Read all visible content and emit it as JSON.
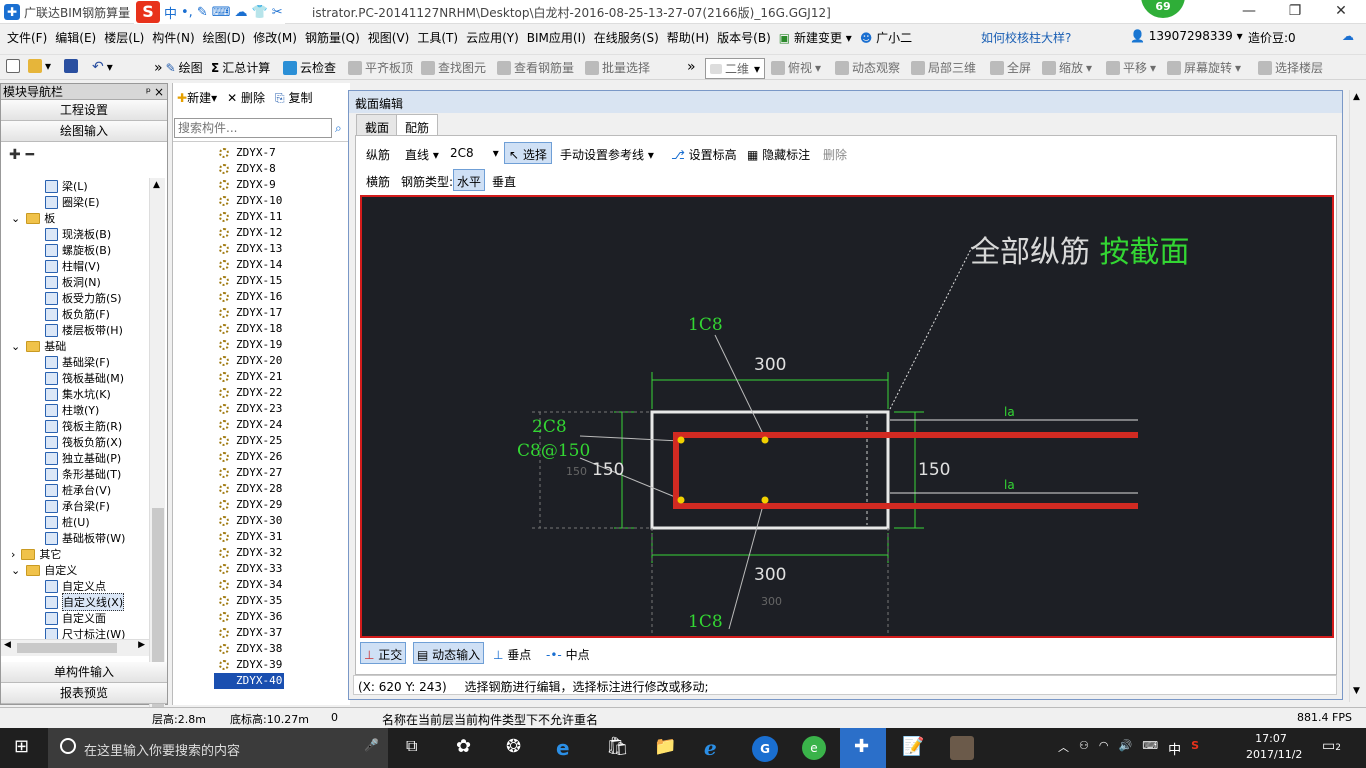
{
  "window": {
    "title_left": "广联达BIM钢筋算量",
    "title_right": "istrator.PC-20141127NRHM\\Desktop\\白龙村-2016-08-25-13-27-07(2166版)_16G.GGJ12]",
    "badge_count": "69",
    "ime_items": [
      "中",
      "•,",
      "✎",
      "⌨",
      "☁",
      "👕",
      "✂"
    ]
  },
  "menu": {
    "items": [
      "文件(F)",
      "编辑(E)",
      "楼层(L)",
      "构件(N)",
      "绘图(D)",
      "修改(M)",
      "钢筋量(Q)",
      "视图(V)",
      "工具(T)",
      "云应用(Y)",
      "BIM应用(I)",
      "在线服务(S)",
      "帮助(H)",
      "版本号(B)",
      "新建变更",
      "广小二"
    ],
    "help_link": "如何校核柱大样?",
    "phone": "13907298339",
    "price_label": "造价豆:0"
  },
  "toolbar": {
    "draw": "绘图",
    "calc": "汇总计算",
    "cloud_check": "云检查",
    "flat_top": "平齐板顶",
    "find_elem": "查找图元",
    "view_rebar": "查看钢筋量",
    "batch_select": "批量选择",
    "view_mode": "二维",
    "top_view": "俯视",
    "dynamic": "动态观察",
    "local3d": "局部三维",
    "fullscreen": "全屏",
    "zoom": "缩放",
    "pan": "平移",
    "rotate": "屏幕旋转",
    "select_floor": "选择楼层"
  },
  "nav": {
    "header": "模块导航栏",
    "pin": "ᵖ",
    "close": "×",
    "btn_project": "工程设置",
    "btn_drawing": "绘图输入",
    "btn_single": "单构件输入",
    "btn_report": "报表预览",
    "tree": [
      {
        "label": "梁(L)",
        "indent": 2,
        "kind": "item"
      },
      {
        "label": "圈梁(E)",
        "indent": 2,
        "kind": "item"
      },
      {
        "label": "板",
        "indent": 1,
        "kind": "folder"
      },
      {
        "label": "现浇板(B)",
        "indent": 2,
        "kind": "item"
      },
      {
        "label": "螺旋板(B)",
        "indent": 2,
        "kind": "item"
      },
      {
        "label": "柱帽(V)",
        "indent": 2,
        "kind": "item"
      },
      {
        "label": "板洞(N)",
        "indent": 2,
        "kind": "item"
      },
      {
        "label": "板受力筋(S)",
        "indent": 2,
        "kind": "item"
      },
      {
        "label": "板负筋(F)",
        "indent": 2,
        "kind": "item"
      },
      {
        "label": "楼层板带(H)",
        "indent": 2,
        "kind": "item"
      },
      {
        "label": "基础",
        "indent": 1,
        "kind": "folder"
      },
      {
        "label": "基础梁(F)",
        "indent": 2,
        "kind": "item"
      },
      {
        "label": "筏板基础(M)",
        "indent": 2,
        "kind": "item"
      },
      {
        "label": "集水坑(K)",
        "indent": 2,
        "kind": "item"
      },
      {
        "label": "柱墩(Y)",
        "indent": 2,
        "kind": "item"
      },
      {
        "label": "筏板主筋(R)",
        "indent": 2,
        "kind": "item"
      },
      {
        "label": "筏板负筋(X)",
        "indent": 2,
        "kind": "item"
      },
      {
        "label": "独立基础(P)",
        "indent": 2,
        "kind": "item"
      },
      {
        "label": "条形基础(T)",
        "indent": 2,
        "kind": "item"
      },
      {
        "label": "桩承台(V)",
        "indent": 2,
        "kind": "item"
      },
      {
        "label": "承台梁(F)",
        "indent": 2,
        "kind": "item"
      },
      {
        "label": "桩(U)",
        "indent": 2,
        "kind": "item"
      },
      {
        "label": "基础板带(W)",
        "indent": 2,
        "kind": "item"
      },
      {
        "label": "其它",
        "indent": 1,
        "kind": "folder-collapsed"
      },
      {
        "label": "自定义",
        "indent": 1,
        "kind": "folder"
      },
      {
        "label": "自定义点",
        "indent": 2,
        "kind": "item"
      },
      {
        "label": "自定义线(X)",
        "indent": 2,
        "kind": "item-selected"
      },
      {
        "label": "自定义面",
        "indent": 2,
        "kind": "item"
      },
      {
        "label": "尺寸标注(W)",
        "indent": 2,
        "kind": "item"
      }
    ]
  },
  "complist": {
    "new": "新建",
    "delete": "删除",
    "copy": "复制",
    "search_placeholder": "搜索构件...",
    "items": [
      "ZDYX-7",
      "ZDYX-8",
      "ZDYX-9",
      "ZDYX-10",
      "ZDYX-11",
      "ZDYX-12",
      "ZDYX-13",
      "ZDYX-14",
      "ZDYX-15",
      "ZDYX-16",
      "ZDYX-17",
      "ZDYX-18",
      "ZDYX-19",
      "ZDYX-20",
      "ZDYX-21",
      "ZDYX-22",
      "ZDYX-23",
      "ZDYX-24",
      "ZDYX-25",
      "ZDYX-26",
      "ZDYX-27",
      "ZDYX-28",
      "ZDYX-29",
      "ZDYX-30",
      "ZDYX-31",
      "ZDYX-32",
      "ZDYX-33",
      "ZDYX-34",
      "ZDYX-35",
      "ZDYX-36",
      "ZDYX-37",
      "ZDYX-38",
      "ZDYX-39",
      "ZDYX-40"
    ],
    "selected": "ZDYX-40"
  },
  "dialog": {
    "title": "截面编辑",
    "tabs": [
      "截面",
      "配筋"
    ],
    "active_tab": "配筋",
    "row1": {
      "longitudinal": "纵筋",
      "line_type": "直线",
      "rebar": "2C8",
      "select": "选择",
      "manual_ref": "手动设置参考线",
      "set_elev": "设置标高",
      "hide_label": "隐藏标注",
      "delete": "删除"
    },
    "row2": {
      "transverse": "横筋",
      "rebar_type_label": "钢筋类型:",
      "horizontal": "水平",
      "vertical": "垂直"
    },
    "canvas": {
      "header_white": "全部纵筋",
      "header_green": "按截面",
      "label_1c8_top": "1C8",
      "label_1c8_bottom": "1C8",
      "label_2c8": "2C8",
      "label_stirrup": "C8@150",
      "dim_top": "300",
      "dim_bottom": "300",
      "dim_bottom_ghost": "300",
      "dim_left": "150",
      "dim_left_ghost": "150",
      "dim_right": "150",
      "la_top": "la",
      "la_bottom": "la"
    },
    "bottom_tools": {
      "ortho": "正交",
      "dynamic_input": "动态输入",
      "perp": "垂点",
      "mid": "中点"
    },
    "status_coords": "(X: 620 Y: 243)",
    "status_msg": "选择钢筋进行编辑，选择标注进行修改或移动;"
  },
  "statusbar": {
    "floor_height": "层高:2.8m",
    "bottom_elev": "底标高:10.27m",
    "zero": "0",
    "message": "名称在当前层当前构件类型下不允许重名",
    "fps": "881.4 FPS"
  },
  "taskbar": {
    "search_placeholder": "在这里输入你要搜索的内容",
    "time": "17:07",
    "date": "2017/11/2",
    "lang": "中",
    "notif": "2"
  },
  "colors": {
    "canvas_bg": "#1d1f25",
    "rebar_red": "#d12a22",
    "dim_green": "#33d633",
    "node_yellow": "#f2d000"
  }
}
